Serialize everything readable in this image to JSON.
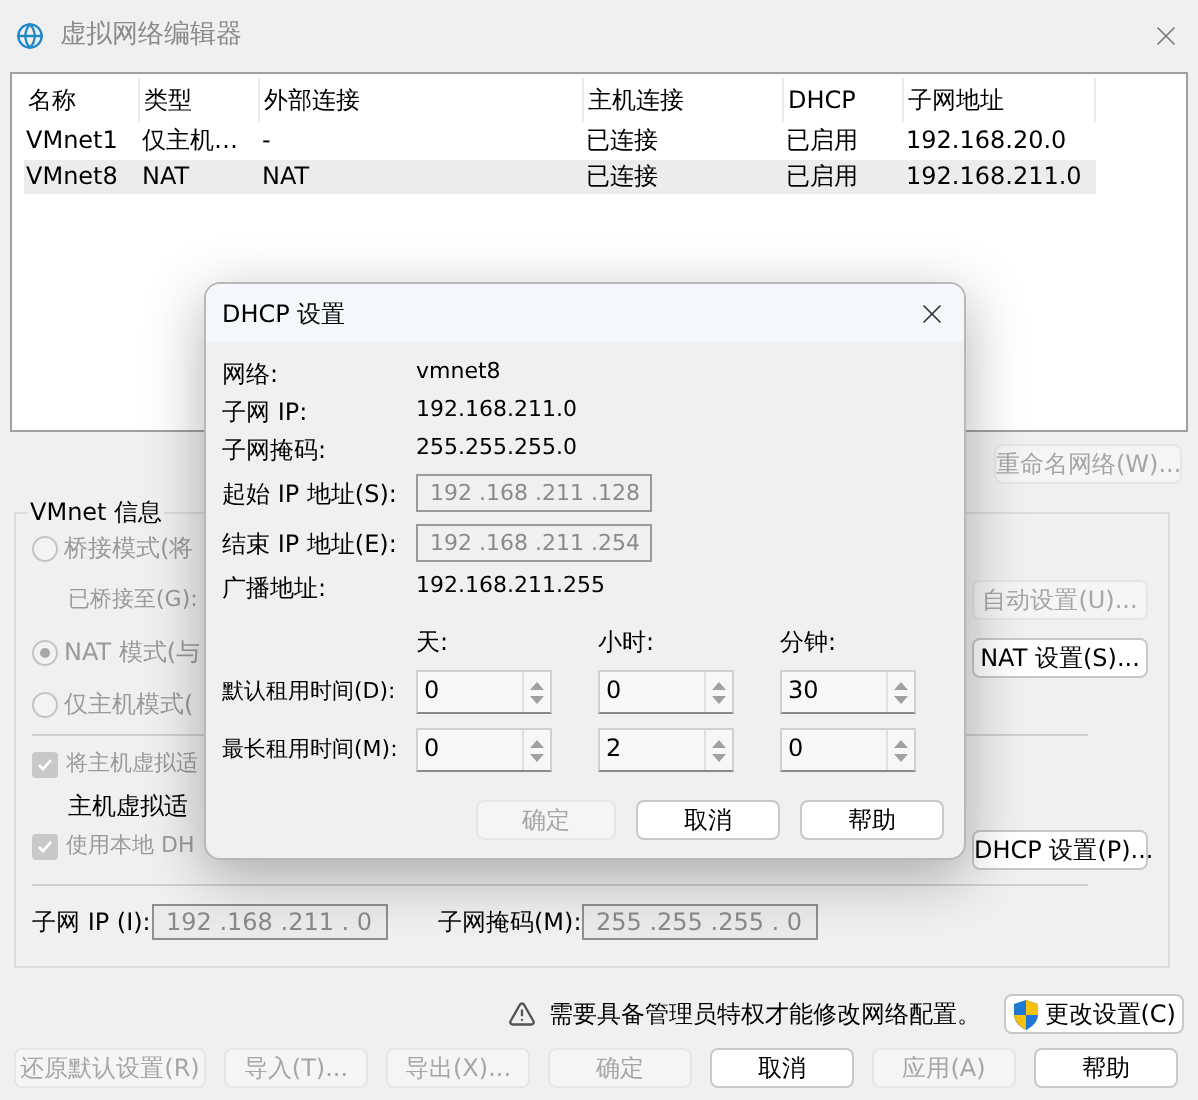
{
  "window": {
    "title": "虚拟网络编辑器"
  },
  "table": {
    "columns": [
      "名称",
      "类型",
      "外部连接",
      "主机连接",
      "DHCP",
      "子网地址"
    ],
    "rows": [
      {
        "cells": [
          "VMnet1",
          "仅主机…",
          "-",
          "已连接",
          "已启用",
          "192.168.20.0"
        ],
        "selected": false
      },
      {
        "cells": [
          "VMnet8",
          "NAT",
          "NAT",
          "已连接",
          "已启用",
          "192.168.211.0"
        ],
        "selected": true
      }
    ]
  },
  "rename_button": {
    "label": "重命名网络(W)...",
    "disabled": true
  },
  "vmnet_info": {
    "title": "VMnet 信息",
    "modes": [
      {
        "label": "桥接模式(将",
        "selected": false,
        "disabled": true
      },
      {
        "kind": "sub",
        "label": "已桥接至(G):",
        "disabled": true
      },
      {
        "label": "NAT 模式(与",
        "selected": true,
        "disabled": true
      },
      {
        "label": "仅主机模式(",
        "selected": false,
        "disabled": true
      }
    ],
    "side_buttons": [
      {
        "label": "自动设置(U)...",
        "disabled": true
      },
      {
        "label": "NAT 设置(S)...",
        "disabled": false
      }
    ],
    "options": [
      {
        "kind": "check",
        "label": "将主机虚拟适",
        "checked": true,
        "disabled": true
      },
      {
        "kind": "sub",
        "label": "主机虚拟适",
        "disabled": false
      },
      {
        "kind": "check",
        "label": "使用本地 DH",
        "checked": true,
        "disabled": true
      }
    ],
    "dhcp_button": {
      "label": "DHCP 设置(P)...",
      "disabled": false
    },
    "subnet_ip": {
      "label": "子网 IP (I):",
      "value": "192 .168 .211 . 0"
    },
    "subnet_mask": {
      "label": "子网掩码(M):",
      "value": "255 .255 .255 . 0"
    }
  },
  "warning": {
    "text": "需要具备管理员特权才能修改网络配置。",
    "button": "更改设置(C)"
  },
  "buttons": [
    {
      "label": "还原默认设置(R)",
      "disabled": true
    },
    {
      "label": "导入(T)...",
      "disabled": true
    },
    {
      "label": "导出(X)...",
      "disabled": true
    },
    {
      "label": "确定",
      "disabled": true
    },
    {
      "label": "取消",
      "disabled": false
    },
    {
      "label": "应用(A)",
      "disabled": true
    },
    {
      "label": "帮助",
      "disabled": false
    }
  ],
  "dialog": {
    "title": "DHCP 设置",
    "fields": [
      {
        "kind": "text",
        "label": "网络:",
        "value": "vmnet8"
      },
      {
        "kind": "text",
        "label": "子网 IP:",
        "value": "192.168.211.0"
      },
      {
        "kind": "text",
        "label": "子网掩码:",
        "value": "255.255.255.0"
      },
      {
        "kind": "ip",
        "label": "起始 IP 地址(S):",
        "value": "192 .168 .211 .128"
      },
      {
        "kind": "ip",
        "label": "结束 IP 地址(E):",
        "value": "192 .168 .211 .254"
      },
      {
        "kind": "text",
        "label": "广播地址:",
        "value": "192.168.211.255"
      }
    ],
    "lease_headers": [
      "天:",
      "小时:",
      "分钟:"
    ],
    "leases": [
      {
        "label": "默认租用时间(D):",
        "values": [
          "0",
          "0",
          "30"
        ]
      },
      {
        "label": "最长租用时间(M):",
        "values": [
          "0",
          "2",
          "0"
        ]
      }
    ],
    "buttons": [
      {
        "label": "确定",
        "disabled": true
      },
      {
        "label": "取消",
        "disabled": false
      },
      {
        "label": "帮助",
        "disabled": false
      }
    ]
  }
}
